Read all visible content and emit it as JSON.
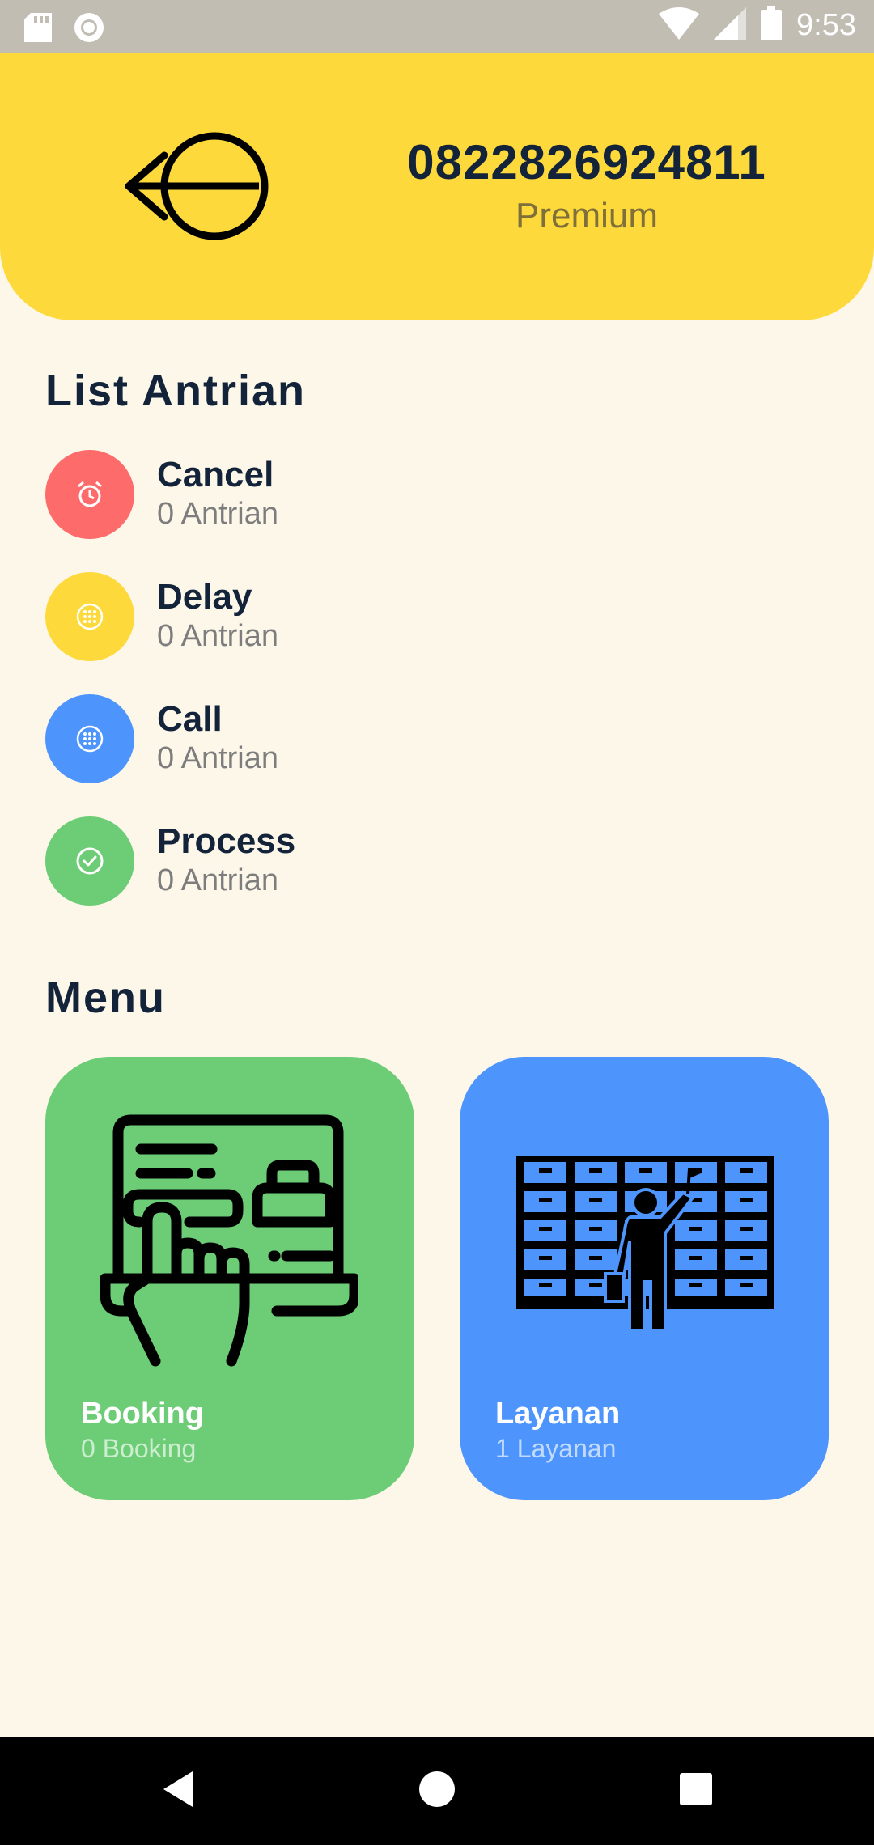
{
  "status_bar": {
    "time": "9:53",
    "left_icons": [
      "sd-card-icon",
      "sync-icon"
    ],
    "right_icons": [
      "wifi-icon",
      "cell-signal-icon",
      "battery-icon"
    ]
  },
  "header": {
    "phone": "0822826924811",
    "plan": "Premium",
    "logout_icon": "logout-icon"
  },
  "queue": {
    "title": "List Antrian",
    "items": [
      {
        "label": "Cancel",
        "count": "0 Antrian",
        "color": "#fd6b6b",
        "icon": "alarm-icon"
      },
      {
        "label": "Delay",
        "count": "0 Antrian",
        "color": "#fdd93b",
        "icon": "dialpad-icon"
      },
      {
        "label": "Call",
        "count": "0 Antrian",
        "color": "#4d95fd",
        "icon": "dialpad-icon"
      },
      {
        "label": "Process",
        "count": "0 Antrian",
        "color": "#6dcc76",
        "icon": "check-circle-icon"
      }
    ]
  },
  "menu": {
    "title": "Menu",
    "cards": [
      {
        "title": "Booking",
        "subtitle": "0 Booking",
        "color": "#6dcc76",
        "icon": "booking-laptop-icon"
      },
      {
        "title": "Layanan",
        "subtitle": "1 Layanan",
        "color": "#4d95fd",
        "icon": "archive-service-icon"
      }
    ]
  },
  "nav": {
    "buttons": [
      "back-icon",
      "home-icon",
      "recents-icon"
    ]
  },
  "colors": {
    "background": "#fdf7ea",
    "header": "#fdd93b",
    "text_dark": "#12233a"
  }
}
